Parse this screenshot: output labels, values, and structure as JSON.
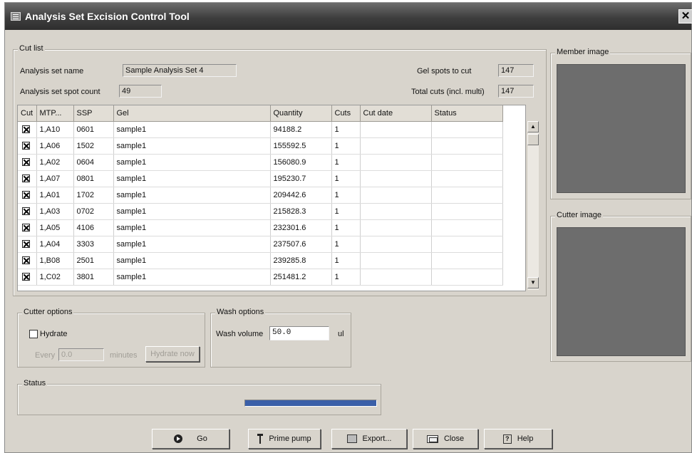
{
  "window": {
    "title": "Analysis Set Excision Control Tool",
    "close_glyph": "✕"
  },
  "cut_list": {
    "legend": "Cut list",
    "analysis_set_name_label": "Analysis set name",
    "analysis_set_name_value": "Sample Analysis Set 4",
    "spot_count_label": "Analysis set spot count",
    "spot_count_value": "49",
    "gel_spots_label": "Gel spots to cut",
    "gel_spots_value": "147",
    "total_cuts_label": "Total cuts (incl. multi)",
    "total_cuts_value": "147",
    "columns": [
      "Cut",
      "MTP...",
      "SSP",
      "Gel",
      "Quantity",
      "Cuts",
      "Cut date",
      "Status"
    ],
    "rows": [
      {
        "cut": true,
        "mtp": "1,A10",
        "ssp": "0601",
        "gel": "sample1",
        "quantity": "94188.2",
        "cuts": "1",
        "cut_date": "",
        "status": ""
      },
      {
        "cut": true,
        "mtp": "1,A06",
        "ssp": "1502",
        "gel": "sample1",
        "quantity": "155592.5",
        "cuts": "1",
        "cut_date": "",
        "status": ""
      },
      {
        "cut": true,
        "mtp": "1,A02",
        "ssp": "0604",
        "gel": "sample1",
        "quantity": "156080.9",
        "cuts": "1",
        "cut_date": "",
        "status": ""
      },
      {
        "cut": true,
        "mtp": "1,A07",
        "ssp": "0801",
        "gel": "sample1",
        "quantity": "195230.7",
        "cuts": "1",
        "cut_date": "",
        "status": ""
      },
      {
        "cut": true,
        "mtp": "1,A01",
        "ssp": "1702",
        "gel": "sample1",
        "quantity": "209442.6",
        "cuts": "1",
        "cut_date": "",
        "status": ""
      },
      {
        "cut": true,
        "mtp": "1,A03",
        "ssp": "0702",
        "gel": "sample1",
        "quantity": "215828.3",
        "cuts": "1",
        "cut_date": "",
        "status": ""
      },
      {
        "cut": true,
        "mtp": "1,A05",
        "ssp": "4106",
        "gel": "sample1",
        "quantity": "232301.6",
        "cuts": "1",
        "cut_date": "",
        "status": ""
      },
      {
        "cut": true,
        "mtp": "1,A04",
        "ssp": "3303",
        "gel": "sample1",
        "quantity": "237507.6",
        "cuts": "1",
        "cut_date": "",
        "status": ""
      },
      {
        "cut": true,
        "mtp": "1,B08",
        "ssp": "2501",
        "gel": "sample1",
        "quantity": "239285.8",
        "cuts": "1",
        "cut_date": "",
        "status": ""
      },
      {
        "cut": true,
        "mtp": "1,C02",
        "ssp": "3801",
        "gel": "sample1",
        "quantity": "251481.2",
        "cuts": "1",
        "cut_date": "",
        "status": ""
      }
    ]
  },
  "member_image": {
    "legend": "Member image"
  },
  "cutter_image": {
    "legend": "Cutter image"
  },
  "cutter_options": {
    "legend": "Cutter options",
    "hydrate_label": "Hydrate",
    "hydrate_checked": false,
    "every_label": "Every",
    "every_value": "0.0",
    "minutes_label": "minutes",
    "hydrate_now_label": "Hydrate now"
  },
  "wash_options": {
    "legend": "Wash options",
    "wash_volume_label": "Wash volume",
    "wash_volume_value": "50.0",
    "unit": "ul"
  },
  "status": {
    "legend": "Status",
    "progress": 1.0
  },
  "buttons": {
    "go": "Go",
    "prime_pump": "Prime pump",
    "export": "Export...",
    "close": "Close",
    "help": "Help",
    "help_glyph": "?"
  },
  "icons": [
    "window-icon",
    "close-icon",
    "go-icon",
    "pump-icon",
    "export-icon",
    "close-window-icon",
    "help-icon",
    "scroll-up-icon",
    "scroll-down-icon"
  ],
  "colors": {
    "titlebar": "#3e3e3e",
    "image_panel": "#6d6d6d",
    "dialog_bg": "#d8d4cc",
    "progress": "#3a5fa8"
  }
}
